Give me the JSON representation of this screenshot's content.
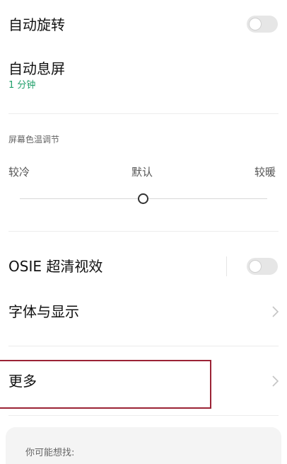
{
  "settings": {
    "auto_rotate": {
      "label": "自动旋转",
      "enabled": false
    },
    "screen_timeout": {
      "label": "自动息屏",
      "value": "1 分钟"
    },
    "color_temp": {
      "section_label": "屏幕色温调节",
      "labels": {
        "cold": "较冷",
        "default": "默认",
        "warm": "较暖"
      },
      "level": 0.5
    },
    "osie": {
      "label": "OSIE 超清视效",
      "enabled": false
    },
    "font_display": {
      "label": "字体与显示"
    },
    "more": {
      "label": "更多"
    }
  },
  "suggestions": {
    "title": "你可能想找:"
  },
  "colors": {
    "accent_green": "#22a06b",
    "highlight_border": "#9b2335",
    "toggle_off": "#e6e6e6"
  },
  "icons": {
    "toggle": "toggle-switch",
    "chevron": "chevron-right-icon"
  }
}
